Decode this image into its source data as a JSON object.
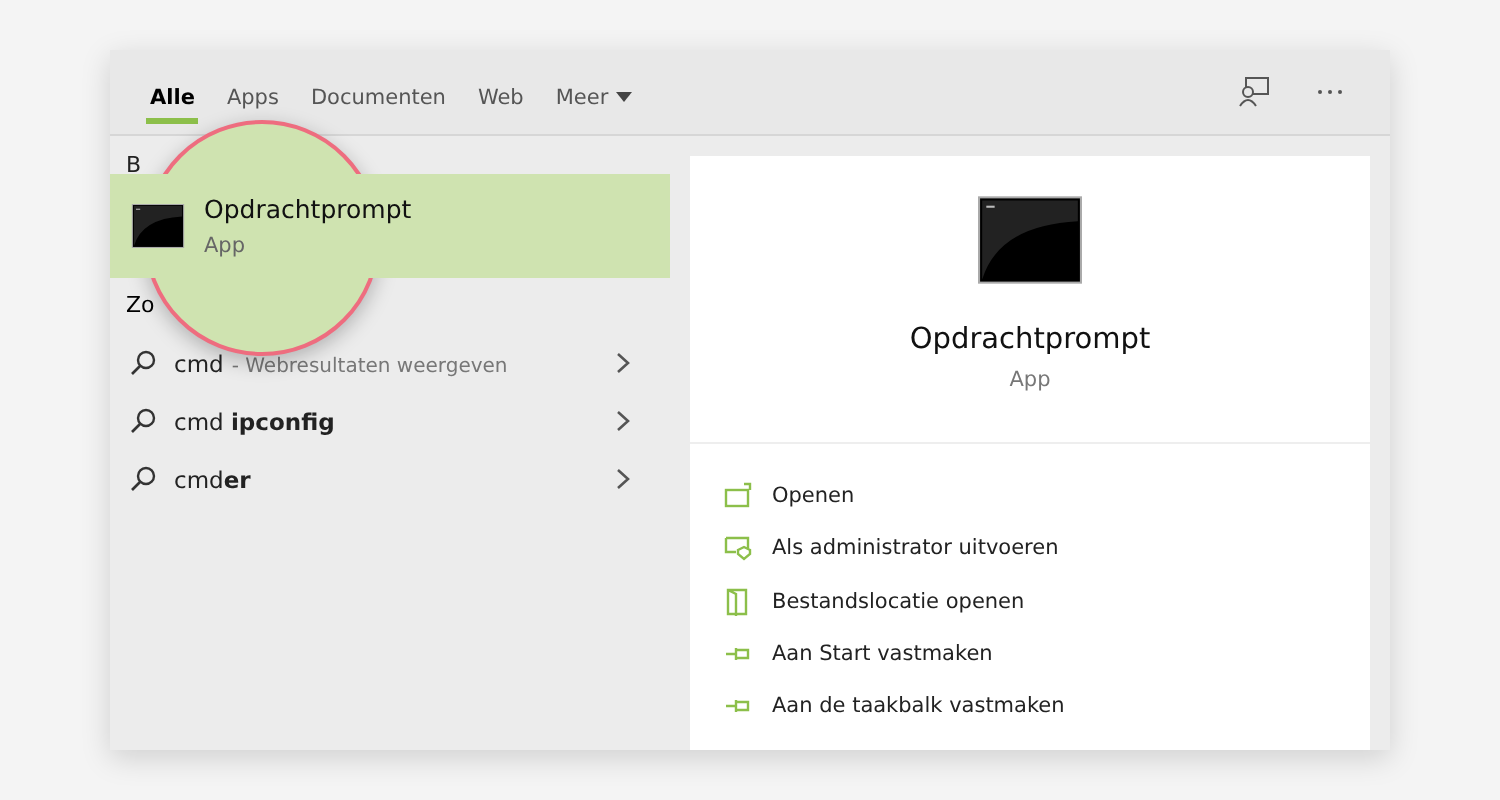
{
  "tabs": [
    {
      "label": "Alle",
      "selected": true
    },
    {
      "label": "Apps",
      "selected": false
    },
    {
      "label": "Documenten",
      "selected": false
    },
    {
      "label": "Web",
      "selected": false
    },
    {
      "label": "Meer",
      "selected": false,
      "dropdown": true
    }
  ],
  "best_match": {
    "header": "B",
    "result": {
      "title": "Opdrachtprompt",
      "subtitle": "App",
      "selected": true
    }
  },
  "suggestions": {
    "header": "Zo",
    "items": [
      {
        "query": "cmd",
        "hint": "- Webresultaten weergeven"
      },
      {
        "query": "cmd **ipconfig**"
      },
      {
        "query": "cmd**er**"
      }
    ]
  },
  "preview": {
    "title": "Opdrachtprompt",
    "subtitle": "App",
    "actions": [
      {
        "label": "Openen",
        "kind": "open"
      },
      {
        "label": "Als administrator uitvoeren",
        "kind": "admin"
      },
      {
        "label": "Bestandslocatie openen",
        "kind": "folder"
      },
      {
        "label": "Aan Start vastmaken",
        "kind": "pin"
      },
      {
        "label": "Aan de taakbalk vastmaken",
        "kind": "pin"
      }
    ]
  }
}
